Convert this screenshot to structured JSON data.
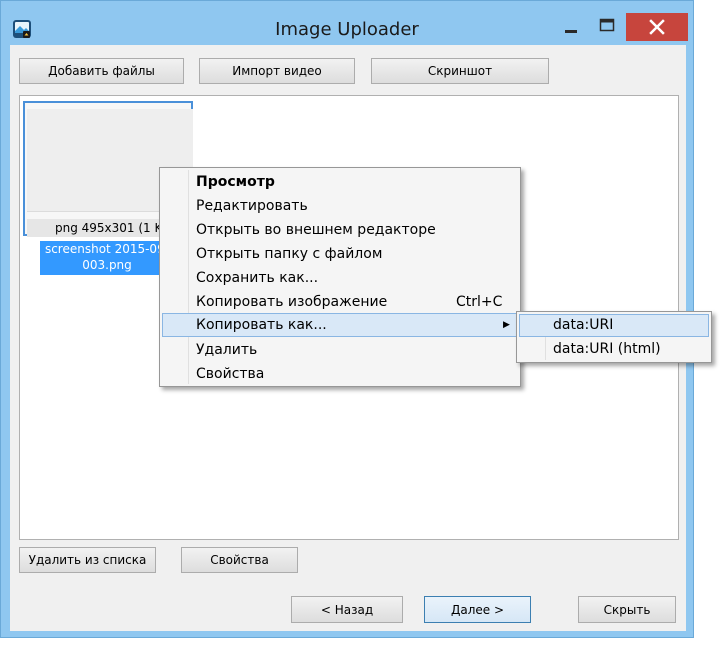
{
  "window": {
    "title": "Image Uploader",
    "accent": "#8fc7f0",
    "close_color": "#c7453d"
  },
  "toolbar": {
    "add_files": "Добавить файлы",
    "import_video": "Импорт видео",
    "screenshot": "Скриншот"
  },
  "file_item": {
    "caption": "png 495x301 (1 KB",
    "name_line1": "screenshot 2015-09-",
    "name_line2": "003.png"
  },
  "context_menu": {
    "items": [
      {
        "label": "Просмотр",
        "bold": true
      },
      {
        "label": "Редактировать"
      },
      {
        "label": "Открыть во внешнем редакторе"
      },
      {
        "label": "Открыть папку с файлом"
      },
      {
        "label": "Сохранить как..."
      },
      {
        "label": "Копировать изображение",
        "shortcut": "Ctrl+C"
      },
      {
        "label": "Копировать как...",
        "submenu": true,
        "highlighted": true
      },
      {
        "label": "Удалить"
      },
      {
        "label": "Свойства"
      }
    ]
  },
  "submenu": {
    "items": [
      {
        "label": "data:URI",
        "highlighted": true
      },
      {
        "label": "data:URI (html)"
      }
    ]
  },
  "bottom_left": {
    "remove_from_list": "Удалить из списка",
    "properties": "Свойства"
  },
  "footer": {
    "back": "< Назад",
    "next": "Далее >",
    "hide": "Скрыть"
  }
}
